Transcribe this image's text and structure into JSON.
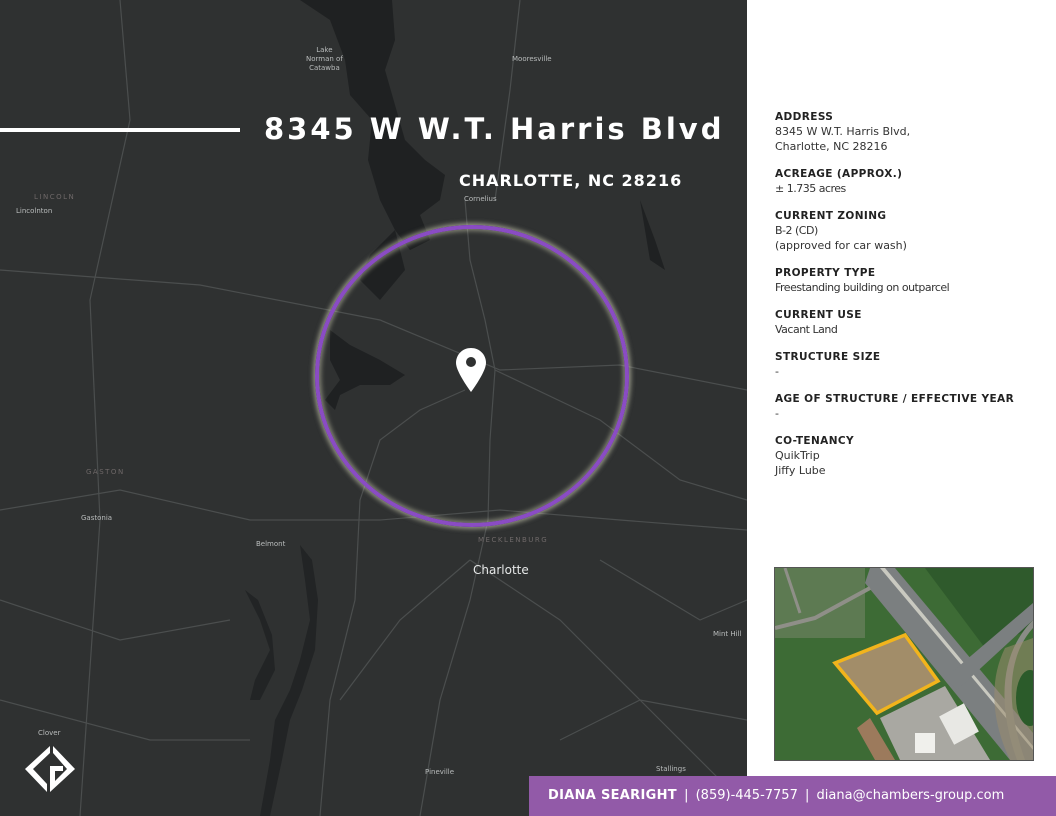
{
  "map": {
    "title": "8345 W W.T. Harris Blvd",
    "subtitle": "CHARLOTTE, NC 28216",
    "labels": {
      "lake_norman_1": "Lake",
      "lake_norman_2": "Norman of",
      "lake_norman_3": "Catawba",
      "mooresville": "Mooresville",
      "lincoln": "LINCOLN",
      "lincolnton": "Lincolnton",
      "cornelius": "Cornelius",
      "gaston": "GASTON",
      "gastonia": "Gastonia",
      "belmont": "Belmont",
      "mecklenburg": "MECKLENBURG",
      "charlotte": "Charlotte",
      "mint_hill": "Mint Hill",
      "clover": "Clover",
      "pineville": "Pineville",
      "stallings": "Stallings"
    },
    "ring_color": "#8a4cc4",
    "pin_icon": "map-pin-icon",
    "logo_icon": "chambers-group-logo"
  },
  "details": [
    {
      "label": "ADDRESS",
      "lines": [
        "8345 W W.T. Harris Blvd,",
        "Charlotte, NC 28216"
      ]
    },
    {
      "label": "ACREAGE (APPROX.)",
      "lines": [
        "± 1.735 acres"
      ]
    },
    {
      "label": "CURRENT ZONING",
      "lines": [
        "B-2 (CD)",
        "(approved for car wash)"
      ]
    },
    {
      "label": "PROPERTY TYPE",
      "lines": [
        "Freestanding building on outparcel"
      ]
    },
    {
      "label": "CURRENT USE",
      "lines": [
        "Vacant Land"
      ]
    },
    {
      "label": "STRUCTURE SIZE",
      "lines": [
        "-"
      ]
    },
    {
      "label": "AGE OF STRUCTURE / EFFECTIVE YEAR",
      "lines": [
        "-"
      ]
    },
    {
      "label": "CO-TENANCY",
      "lines": [
        "QuikTrip",
        "Jiffy Lube"
      ]
    }
  ],
  "aerial": {
    "parcel_outline_color": "#f2b41c"
  },
  "contact": {
    "name": "DIANA SEARIGHT",
    "separator": "|",
    "phone": "(859)-445-7757",
    "email": "diana@chambers-group.com",
    "bar_color": "#925aa8"
  }
}
